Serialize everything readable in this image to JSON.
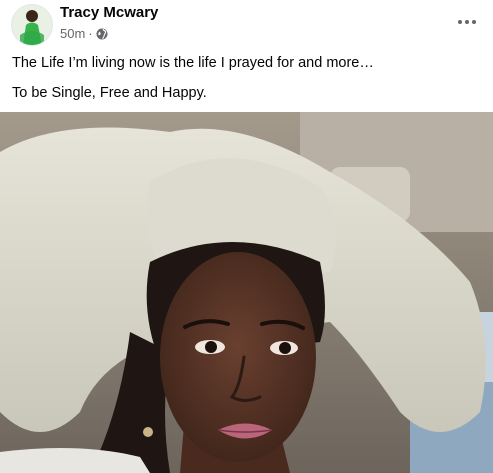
{
  "post": {
    "author_name": "Tracy Mcwary",
    "timestamp": "50m",
    "separator": "·",
    "privacy_icon": "globe-icon",
    "more_icon": "more-horizontal-icon",
    "text_lines": [
      "The Life I’m living now is the life I prayed for and more…",
      "To be Single, Free and Happy."
    ],
    "photo": {
      "alt": "selfie"
    }
  },
  "colors": {
    "author_text": "#050505",
    "meta_text": "#65676b",
    "hat": "#d8d6c8",
    "skin": "#5a3526"
  }
}
